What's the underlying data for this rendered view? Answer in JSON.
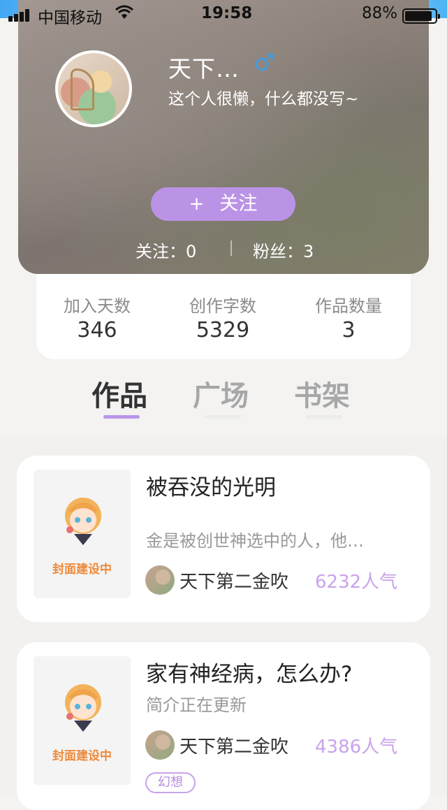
{
  "status_bar": {
    "carrier": "中国移动",
    "time": "19:58",
    "battery": "88%"
  },
  "profile": {
    "nickname": "天下…",
    "gender_symbol": "♂",
    "bio": "这个人很懒，什么都没写~",
    "follow_button": {
      "plus": "+",
      "label": "关注"
    },
    "following": "关注：0",
    "fans": "粉丝：3"
  },
  "stats": [
    {
      "label": "加入天数",
      "value": "346"
    },
    {
      "label": "创作字数",
      "value": "5329"
    },
    {
      "label": "作品数量",
      "value": "3"
    }
  ],
  "tabs": [
    {
      "label": "作品",
      "active": true
    },
    {
      "label": "广场",
      "active": false
    },
    {
      "label": "书架",
      "active": false
    }
  ],
  "works": [
    {
      "cover_caption": "封面建设中",
      "title": "被吞没的光明",
      "description": "金是被创世神选中的人，他…",
      "author": "天下第二金吹",
      "popularity": "6232人气"
    },
    {
      "cover_caption": "封面建设中",
      "title": "家有神经病，怎么办?",
      "description": "简介正在更新",
      "author": "天下第二金吹",
      "popularity": "4386人气",
      "tag": "幻想"
    }
  ],
  "colors": {
    "accent": "#bb93e6",
    "popularity": "#c9a3ea",
    "cover_caption": "#ef8a3a",
    "gender": "#4a9bd8"
  }
}
